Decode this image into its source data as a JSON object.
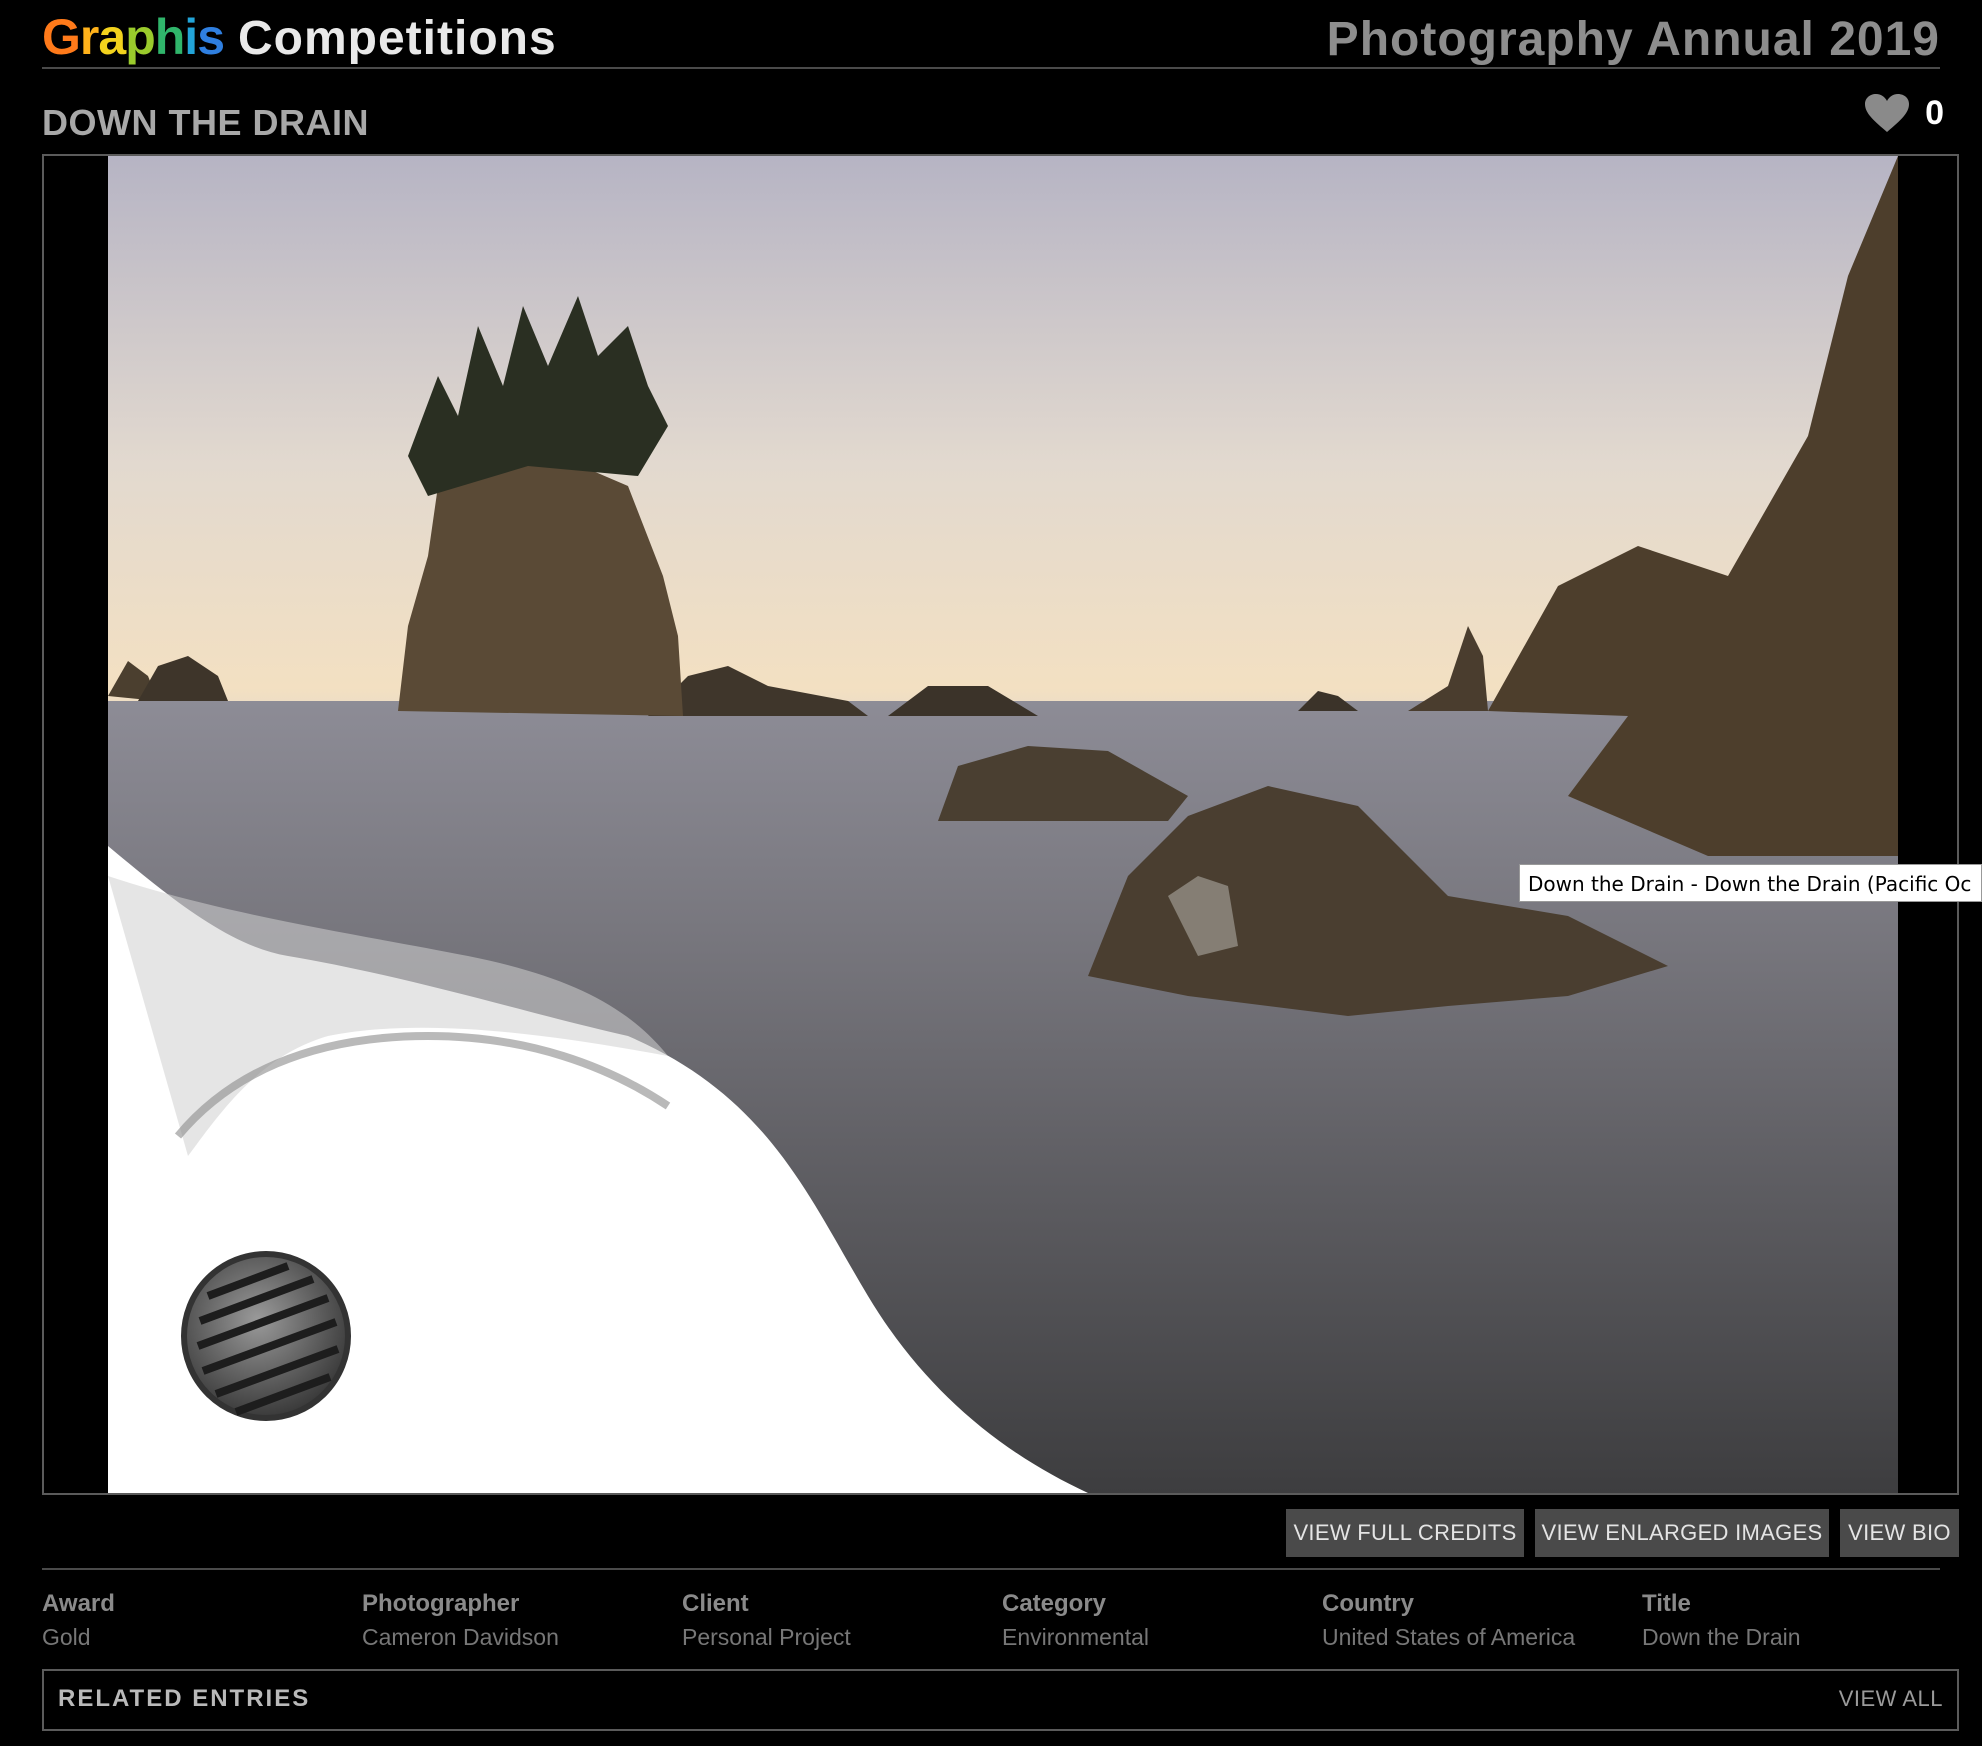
{
  "header": {
    "brand_letters": [
      "G",
      "r",
      "a",
      "p",
      "h",
      "i",
      "s"
    ],
    "brand_suffix": "Competitions",
    "annual": "Photography Annual 2019"
  },
  "entry": {
    "title": "DOWN THE DRAIN",
    "likes": "0",
    "tooltip": "Down the Drain - Down the Drain (Pacific Oc"
  },
  "buttons": {
    "full_credits": "VIEW FULL CREDITS",
    "enlarged": "VIEW ENLARGED IMAGES",
    "bio": "VIEW BIO"
  },
  "meta": [
    {
      "label": "Award",
      "value": "Gold"
    },
    {
      "label": "Photographer",
      "value": "Cameron Davidson"
    },
    {
      "label": "Client",
      "value": "Personal Project"
    },
    {
      "label": "Category",
      "value": "Environmental"
    },
    {
      "label": "Country",
      "value": "United States of America"
    },
    {
      "label": "Title",
      "value": "Down the Drain"
    }
  ],
  "related": {
    "title": "RELATED ENTRIES",
    "view_all": "VIEW ALL"
  },
  "colors": {
    "background": "#000000",
    "button_bg": "#4a4a4a",
    "annual_text": "#8d8d8d"
  },
  "icons": {
    "like": "heart-icon"
  }
}
